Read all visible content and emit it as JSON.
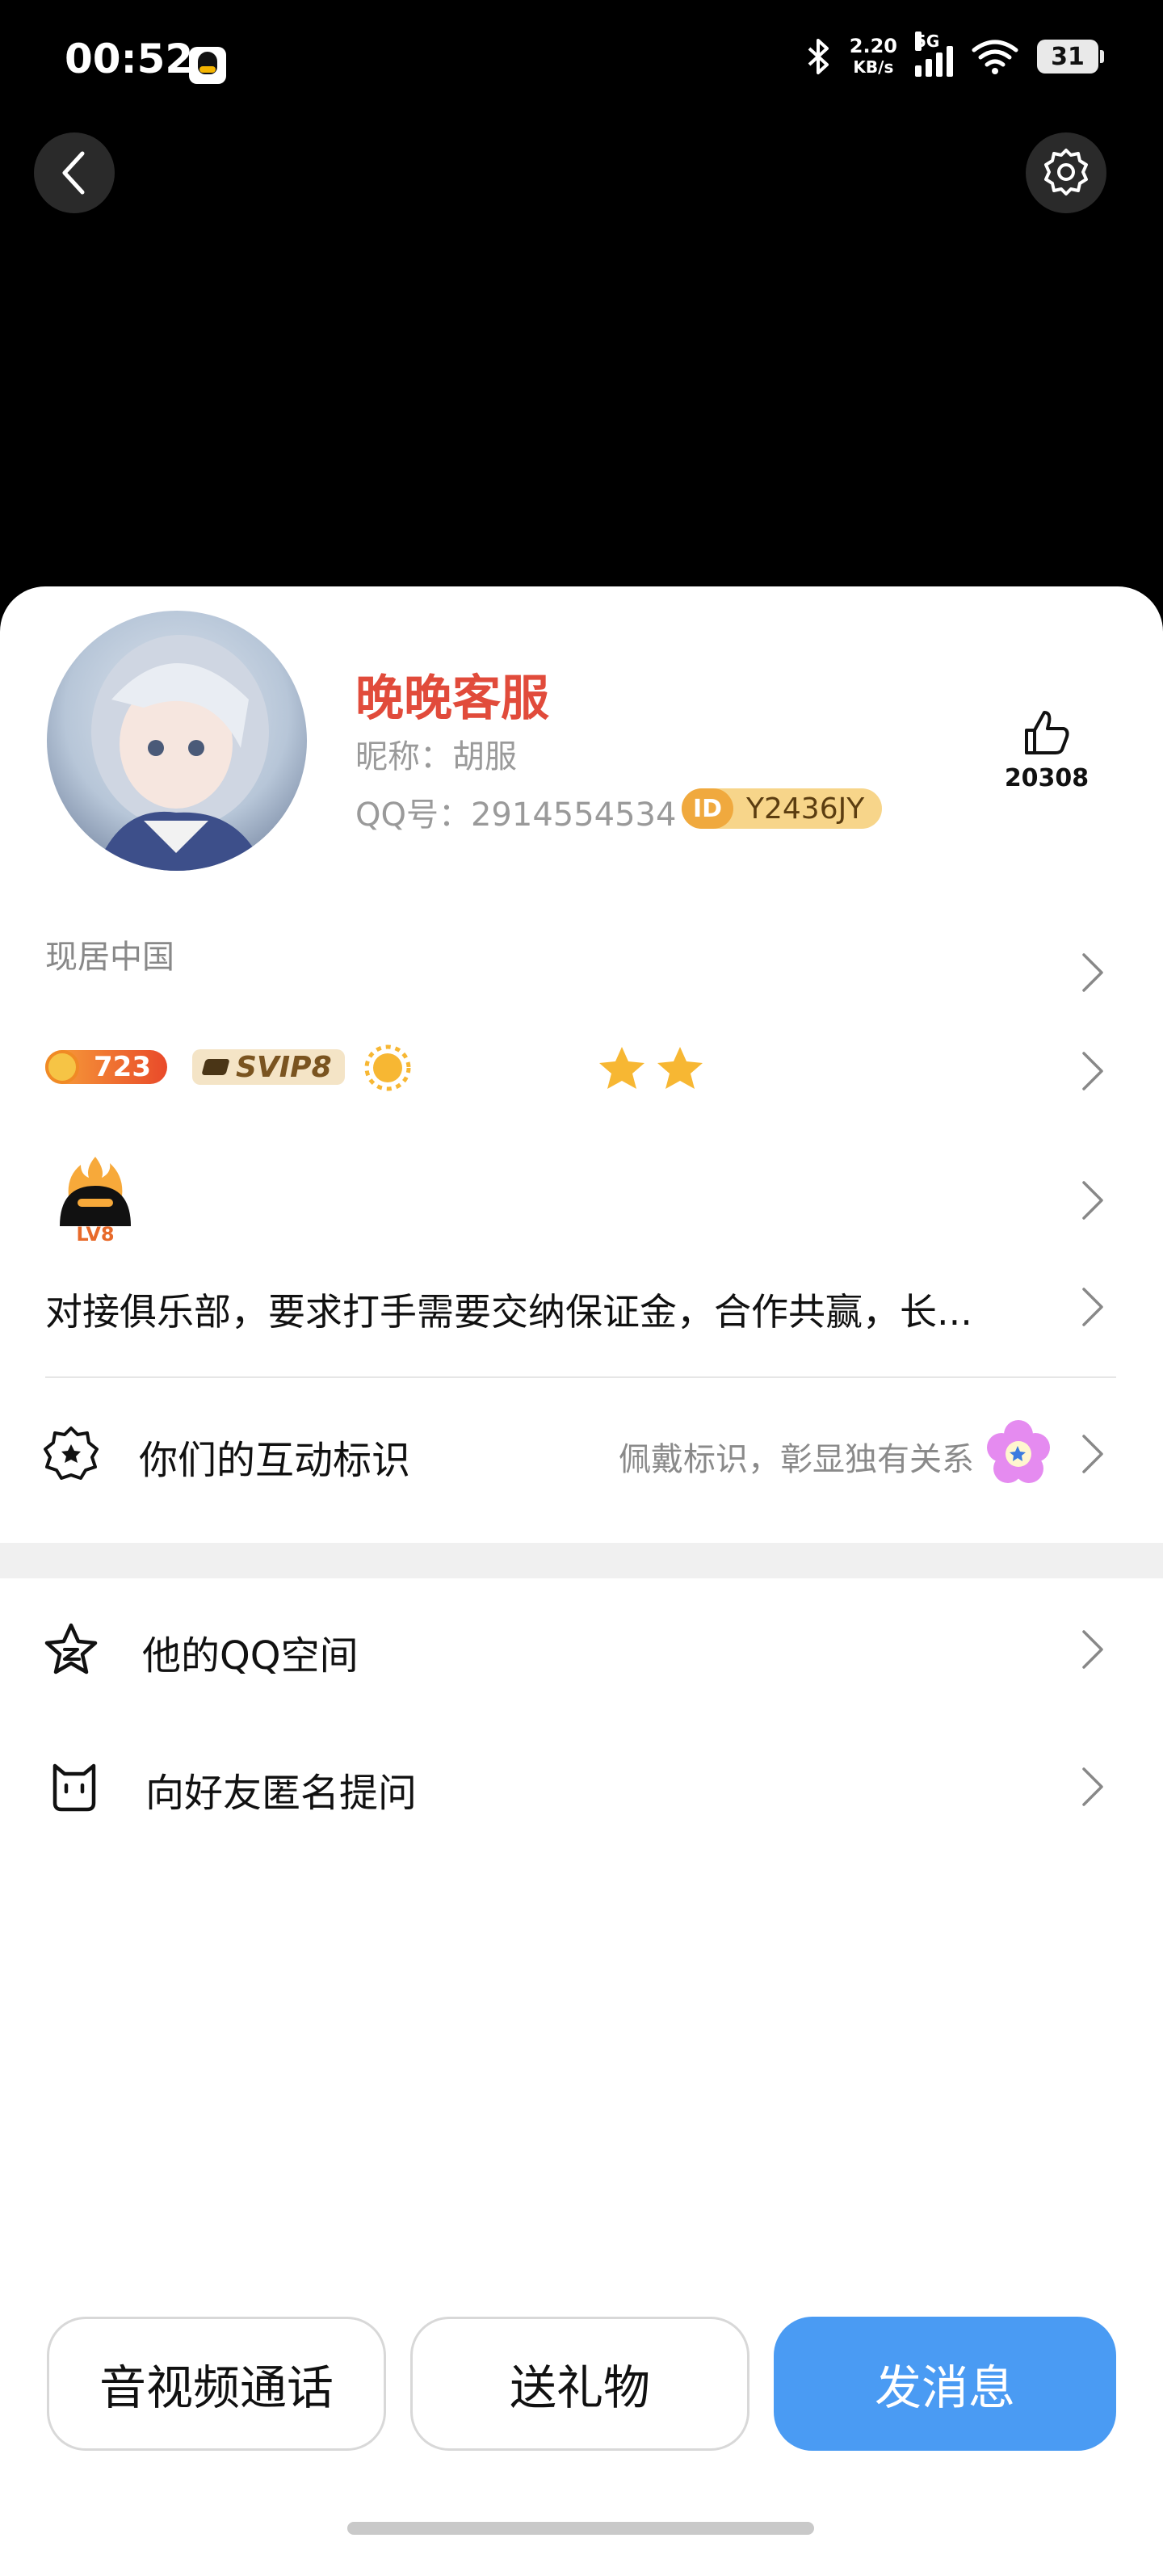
{
  "status_bar": {
    "time": "00:52",
    "net_speed": "2.20",
    "net_unit": "KB/s",
    "network": "5G",
    "battery": "31"
  },
  "header": {
    "back_icon": "chevron-left-icon",
    "settings_icon": "gear-icon"
  },
  "profile": {
    "name": "晚晚客服",
    "nickname": "昵称：胡服",
    "qq_number": "QQ号：2914554534",
    "id_badge": "Y2436JY",
    "id_mark": "ID",
    "likes": "20308"
  },
  "location": "现居中国",
  "badges": {
    "level_value": "723",
    "svip": "SVIP8"
  },
  "lv_badge": "LV8",
  "signature": "对接俱乐部，要求打手需要交纳保证金，合作共赢，长...",
  "interaction": {
    "label": "你们的互动标识",
    "hint": "佩戴标识，彰显独有关系"
  },
  "menu": [
    {
      "label": "他的QQ空间"
    },
    {
      "label": "向好友匿名提问"
    }
  ],
  "actions": {
    "call": "音视频通话",
    "gift": "送礼物",
    "message": "发消息"
  },
  "colors": {
    "name_red": "#e14b3b",
    "primary_blue": "#4a9bf3"
  }
}
